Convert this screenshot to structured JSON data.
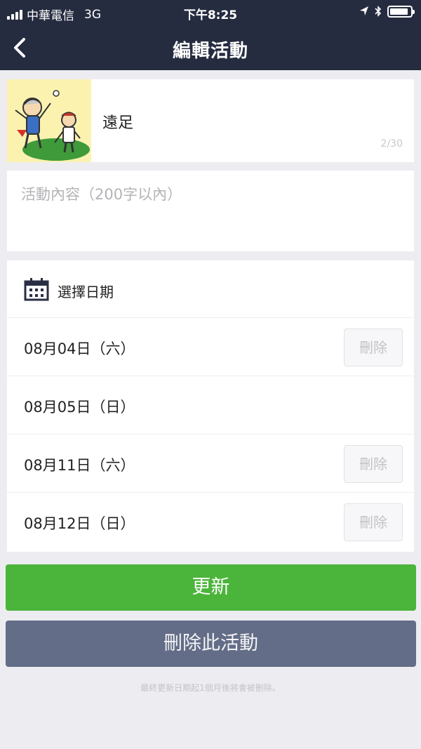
{
  "status_bar": {
    "carrier": "中華電信",
    "network": "3G",
    "time": "下午8:25"
  },
  "nav": {
    "title": "編輯活動"
  },
  "event": {
    "title": "遠足",
    "title_counter": "2/30",
    "content_placeholder": "活動內容（200字以內）"
  },
  "dates": {
    "header_label": "選擇日期",
    "delete_label": "刪除",
    "rows": [
      {
        "label": "08月04日（六）",
        "deletable": true
      },
      {
        "label": "08月05日（日）",
        "deletable": false
      },
      {
        "label": "08月11日（六）",
        "deletable": true
      },
      {
        "label": "08月12日（日）",
        "deletable": true
      }
    ]
  },
  "actions": {
    "update_label": "更新",
    "delete_event_label": "刪除此活動"
  },
  "footnote": "最終更新日期起1個月後將會被刪除。",
  "colors": {
    "navbar": "#262c40",
    "update_button": "#4bb43a",
    "delete_event_button": "#636d87",
    "background": "#ededf1"
  }
}
